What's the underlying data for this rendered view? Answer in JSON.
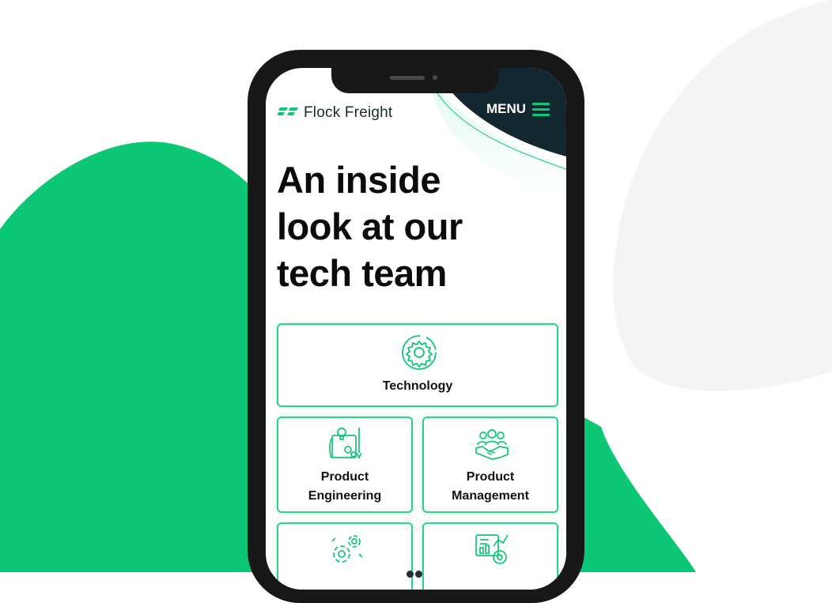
{
  "header": {
    "brand_name": "Flock Freight",
    "menu_label": "MENU"
  },
  "hero": {
    "headline_lines": [
      "An inside",
      "look at our",
      "tech team"
    ]
  },
  "cards": {
    "technology": {
      "label": "Technology",
      "icon": "gear-icon"
    },
    "product_engineering": {
      "line1": "Product",
      "line2": "Engineering",
      "icon": "blueprint-icon"
    },
    "product_management": {
      "line1": "Product",
      "line2": "Management",
      "icon": "team-handshake-icon"
    },
    "card_four": {
      "icon": "gears-icon"
    },
    "card_five": {
      "icon": "analytics-icon"
    }
  },
  "colors": {
    "brand_green": "#0cc776",
    "dark_navy": "#132730",
    "phone_frame": "#181818",
    "card_border": "#2bd08a"
  }
}
